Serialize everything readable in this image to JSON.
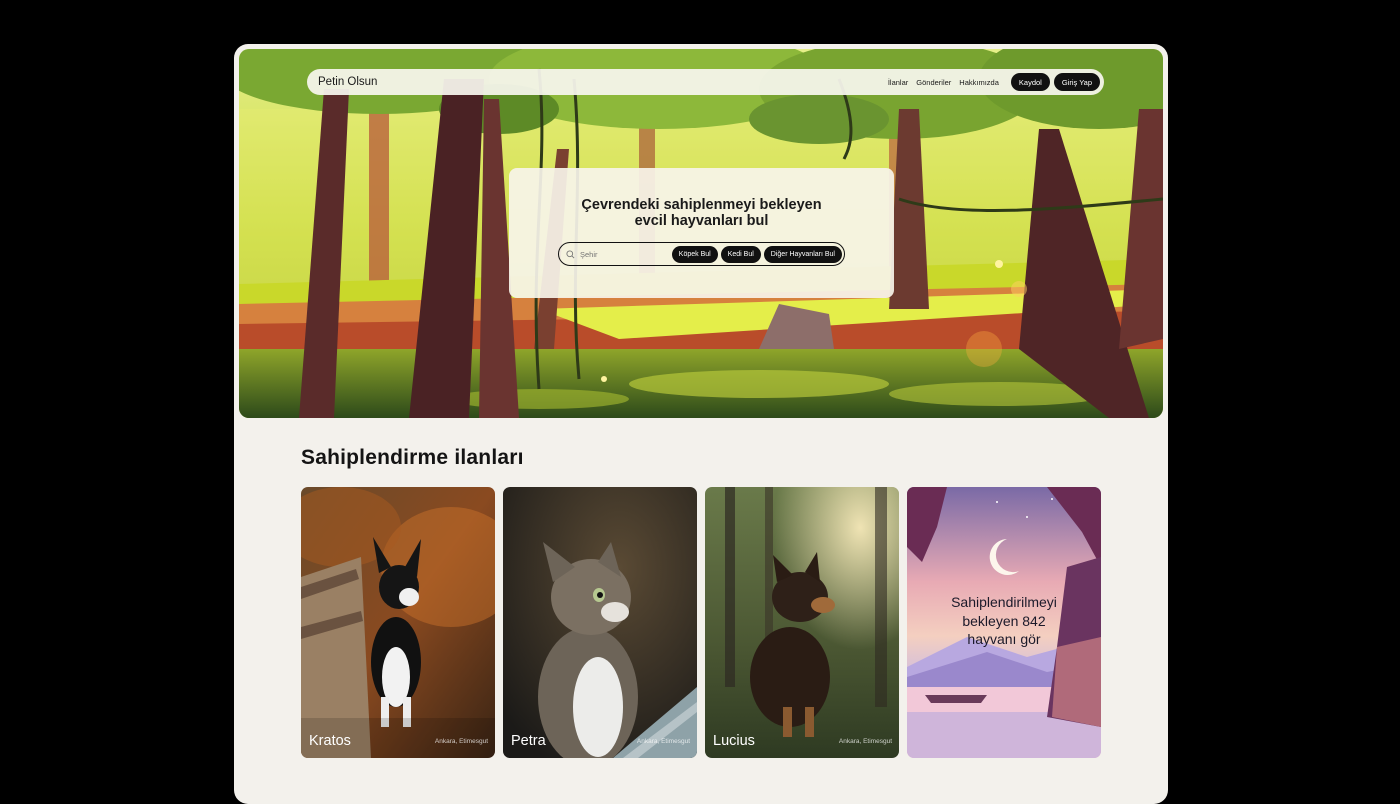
{
  "navbar": {
    "brand": "Petin Olsun",
    "links": [
      "İlanlar",
      "Gönderiler",
      "Hakkımızda"
    ],
    "signup_label": "Kaydol",
    "login_label": "Giriş Yap"
  },
  "hero": {
    "title": "Çevrendeki sahiplenmeyi bekleyen evcil hayvanları bul",
    "search_placeholder": "Şehir",
    "buttons": [
      "Köpek Bul",
      "Kedi Bul",
      "Diğer Hayvanları Bul"
    ]
  },
  "listings": {
    "title": "Sahiplendirme ilanları",
    "cards": [
      {
        "name": "Kratos",
        "location": "Ankara, Etimesgut"
      },
      {
        "name": "Petra",
        "location": "Ankara, Etimesgut"
      },
      {
        "name": "Lucius",
        "location": "Ankara, Etimesgut"
      }
    ],
    "promo": "Sahiplendirilmeyi bekleyen 842 hayvanı gör"
  },
  "colors": {
    "background": "#000000",
    "page": "#f3f1ec",
    "button": "#111111",
    "forest_light": "#c9dc2a",
    "forest_ground": "#d8d82f"
  }
}
